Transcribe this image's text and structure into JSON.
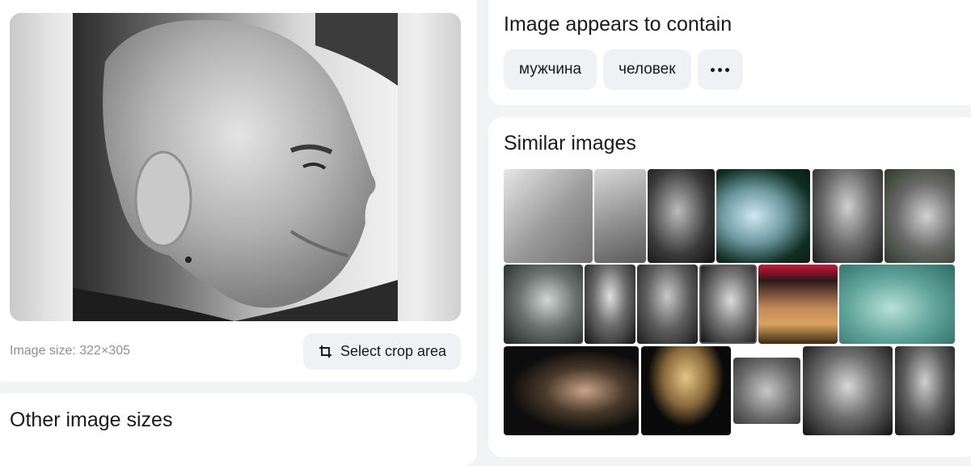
{
  "preview": {
    "image_size_text": "Image size: 322×305",
    "crop_button_label": "Select crop area"
  },
  "other_sizes": {
    "title": "Other image sizes"
  },
  "contains": {
    "title": "Image appears to contain",
    "tags": [
      "мужчина",
      "человек"
    ]
  },
  "similar": {
    "title": "Similar images",
    "thumb_count": 17
  }
}
